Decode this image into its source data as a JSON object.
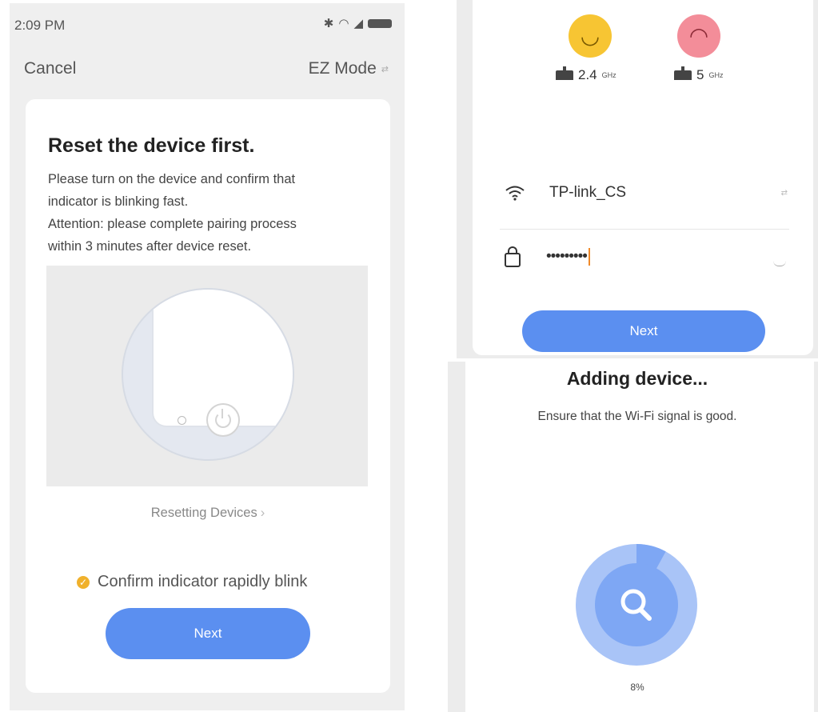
{
  "status_bar": {
    "time": "2:09 PM"
  },
  "top_bar": {
    "cancel": "Cancel",
    "mode": "EZ Mode"
  },
  "reset_card": {
    "title": "Reset the device first.",
    "description_lines": [
      "Please turn on the device and confirm that",
      "indicator is blinking fast.",
      "Attention: please complete pairing process",
      "within 3 minutes after device reset."
    ],
    "resetting_link": "Resetting Devices",
    "confirm_label": "Confirm indicator rapidly blink",
    "next_label": "Next"
  },
  "wifi_setup": {
    "bands": [
      {
        "label": "2.4",
        "unit": "GHz",
        "face": "happy"
      },
      {
        "label": "5",
        "unit": "GHz",
        "face": "sad"
      }
    ],
    "ssid": "TP-link_CS",
    "password_masked": "•••••••••",
    "next_label": "Next"
  },
  "adding": {
    "title": "Adding device...",
    "subtitle": "Ensure that the Wi-Fi signal is good.",
    "progress_text": "8%",
    "progress_value": 0.08
  },
  "colors": {
    "accent": "#5b8ff0",
    "ring_light": "#a9c4f7",
    "ring_mid": "#7ea7f4",
    "check": "#f0b12c",
    "happy_face": "#f7c533",
    "sad_face": "#f38d99",
    "cursor": "#f08a2a"
  },
  "icons": [
    "bluetooth-icon",
    "wifi-icon",
    "signal-icon",
    "battery-icon",
    "swap-icon",
    "chevron-right-icon",
    "check-circle-icon",
    "router-icon",
    "lock-icon",
    "eye-hidden-icon",
    "search-icon",
    "power-icon"
  ]
}
